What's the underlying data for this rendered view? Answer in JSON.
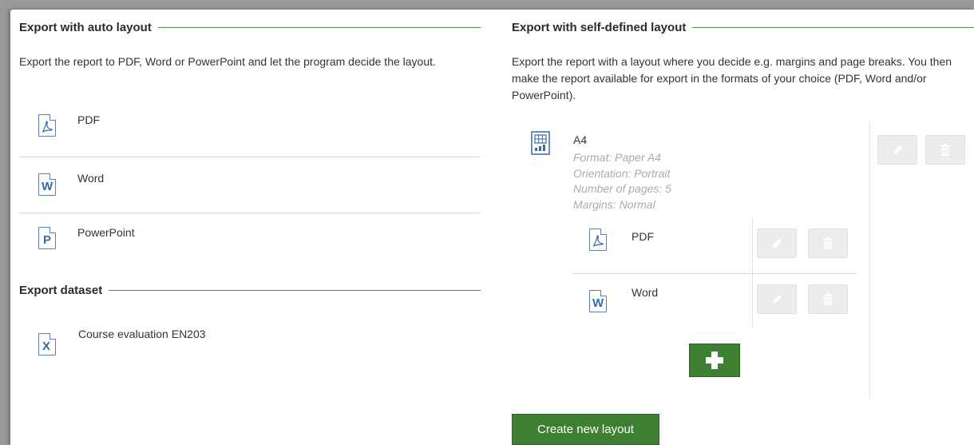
{
  "auto_layout": {
    "title": "Export with auto layout",
    "description": "Export the report to PDF, Word or PowerPoint and let the program decide the layout.",
    "items": [
      {
        "label": "PDF",
        "icon": "pdf-file-icon"
      },
      {
        "label": "Word",
        "icon": "word-file-icon"
      },
      {
        "label": "PowerPoint",
        "icon": "powerpoint-file-icon"
      }
    ]
  },
  "dataset": {
    "title": "Export dataset",
    "items": [
      {
        "label": "Course evaluation EN203",
        "icon": "excel-file-icon"
      }
    ]
  },
  "self_layout": {
    "title": "Export with self-defined layout",
    "description": "Export the report with a layout where you decide e.g. margins and page breaks. You then make the report available for export in the formats of your choice (PDF, Word and/or PowerPoint).",
    "layout": {
      "name": "A4",
      "format": "Format: Paper A4",
      "orientation": "Orientation: Portrait",
      "pages": "Number of pages: 5",
      "margins": "Margins: Normal",
      "formats": [
        {
          "label": "PDF",
          "icon": "pdf-file-icon"
        },
        {
          "label": "Word",
          "icon": "word-file-icon"
        }
      ]
    },
    "create_button": "Create new layout"
  },
  "colors": {
    "accent": "#3f7f32",
    "rule": "#4e8a3e",
    "icon": "#3a68a8",
    "muted": "#aaaaaa"
  }
}
